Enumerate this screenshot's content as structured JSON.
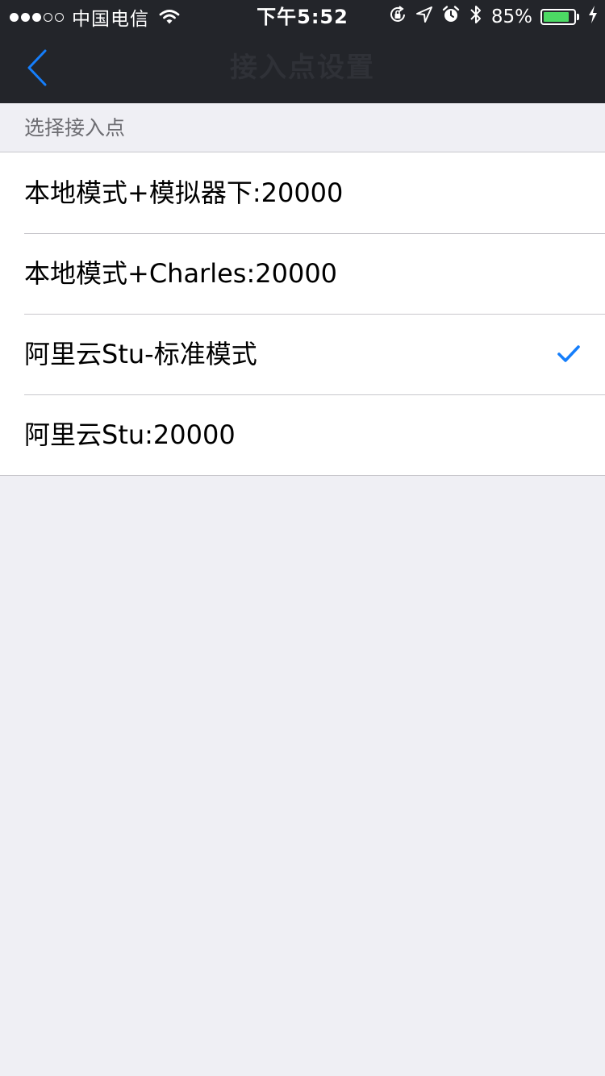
{
  "status_bar": {
    "signal_strength": 3,
    "signal_max": 5,
    "carrier": "中国电信",
    "wifi_icon": "wifi-icon",
    "time": "下午5:52",
    "icons": [
      "orientation-lock-icon",
      "location-arrow-icon",
      "alarm-icon",
      "bluetooth-icon"
    ],
    "battery_percent": "85%",
    "battery_level": 0.85,
    "battery_color": "#4cd964",
    "charging_icon": "charging-bolt-icon"
  },
  "nav": {
    "back_icon": "chevron-left-icon",
    "title": "接入点设置"
  },
  "section": {
    "header": "选择接入点"
  },
  "access_points": [
    {
      "label": "本地模式+模拟器下:20000",
      "selected": false
    },
    {
      "label": "本地模式+Charles:20000",
      "selected": false
    },
    {
      "label": "阿里云Stu-标准模式",
      "selected": true
    },
    {
      "label": "阿里云Stu:20000",
      "selected": false
    }
  ],
  "colors": {
    "nav_background": "#23252a",
    "accent": "#157efb",
    "page_background": "#efeff4"
  }
}
